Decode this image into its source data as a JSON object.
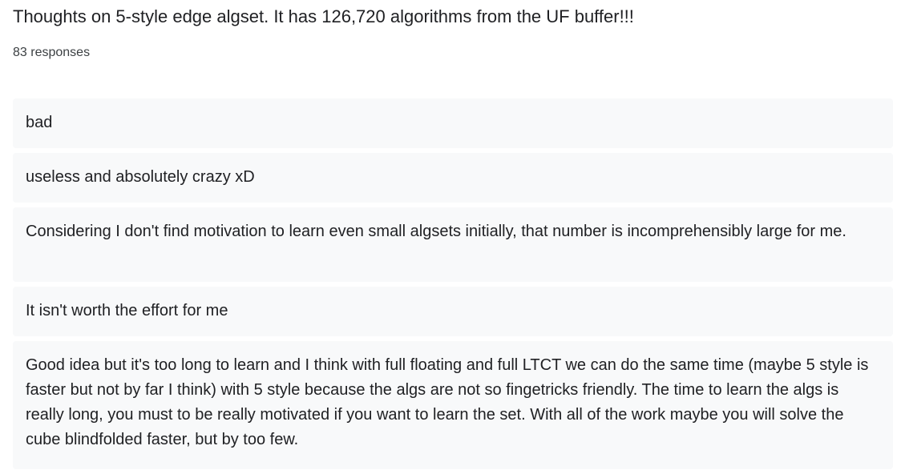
{
  "question": {
    "title": "Thoughts on 5-style edge algset. It has 126,720 algorithms from the UF buffer!!!",
    "response_count": "83 responses"
  },
  "responses": [
    "bad",
    "useless and absolutely crazy xD",
    "Considering I don't find motivation to learn even small algsets initially, that number is incomprehensibly large for me.",
    "It isn't worth the effort for me",
    "Good idea but it's too long to learn and I think with full floating and full LTCT we can do the same time (maybe 5 style is faster but not by far I think) with 5 style because the algs are not so fingetricks friendly. The time to learn the algs is really long, you must to be really motivated if you want to learn the set. With all of the work maybe you will solve the cube blindfolded faster, but by too few."
  ]
}
